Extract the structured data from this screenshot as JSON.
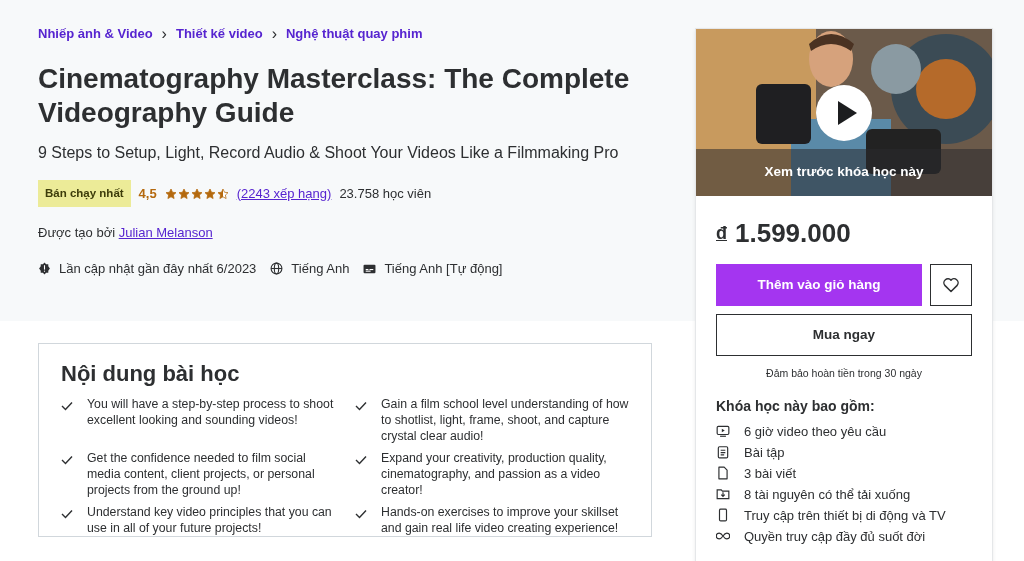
{
  "breadcrumbs": [
    {
      "label": "Nhiếp ảnh & Video"
    },
    {
      "label": "Thiết kế video"
    },
    {
      "label": "Nghệ thuật quay phim"
    }
  ],
  "breadcrumb_separator": "›",
  "title": "Cinematography Masterclass: The Complete Videography Guide",
  "subtitle": "9 Steps to Setup, Light, Record Audio & Shoot Your Videos Like a Filmmaking Pro",
  "badge": "Bán chạy nhất",
  "rating": {
    "value": "4,5",
    "stars": 4.5,
    "count_link": "(2243 xếp hạng)",
    "students": "23.758 học viên"
  },
  "creator": {
    "label": "Được tạo bởi",
    "name": "Julian Melanson"
  },
  "meta": [
    {
      "kind": "update",
      "text": "Lần cập nhật gần đây nhất 6/2023"
    },
    {
      "kind": "language",
      "text": "Tiếng Anh"
    },
    {
      "kind": "captions",
      "text": "Tiếng Anh [Tự động]"
    }
  ],
  "preview": {
    "caption": "Xem trước khóa học này"
  },
  "price": {
    "currency": "đ",
    "amount": "1.599.000"
  },
  "buttons": {
    "add_to_cart": "Thêm vào giỏ hàng",
    "buy_now": "Mua ngay"
  },
  "guarantee": "Đảm bảo hoàn tiền trong 30 ngày",
  "includes": {
    "heading": "Khóa học này bao gồm:",
    "items": [
      {
        "kind": "video",
        "text": "6 giờ video theo yêu cầu"
      },
      {
        "kind": "assignment",
        "text": "Bài tập"
      },
      {
        "kind": "article",
        "text": "3 bài viết"
      },
      {
        "kind": "download",
        "text": "8 tài nguyên có thể tải xuống"
      },
      {
        "kind": "mobile",
        "text": "Truy cập trên thiết bị di động và TV"
      },
      {
        "kind": "lifetime",
        "text": "Quyền truy cập đầy đủ suốt đời"
      }
    ]
  },
  "learn": {
    "heading": "Nội dung bài học",
    "items": [
      "You will have a step-by-step process to shoot excellent looking and sounding videos!",
      "Gain a film school level understanding of how to shotlist, light, frame, shoot, and capture crystal clear audio!",
      "Get the confidence needed to film social media content, client projects, or personal projects from the ground up!",
      "Expand your creativity, production quality, cinematography, and passion as a video creator!",
      "Understand key video principles that you can use in all of your future projects!",
      "Hands-on exercises to improve your skillset and gain real life video creating experience!"
    ]
  }
}
